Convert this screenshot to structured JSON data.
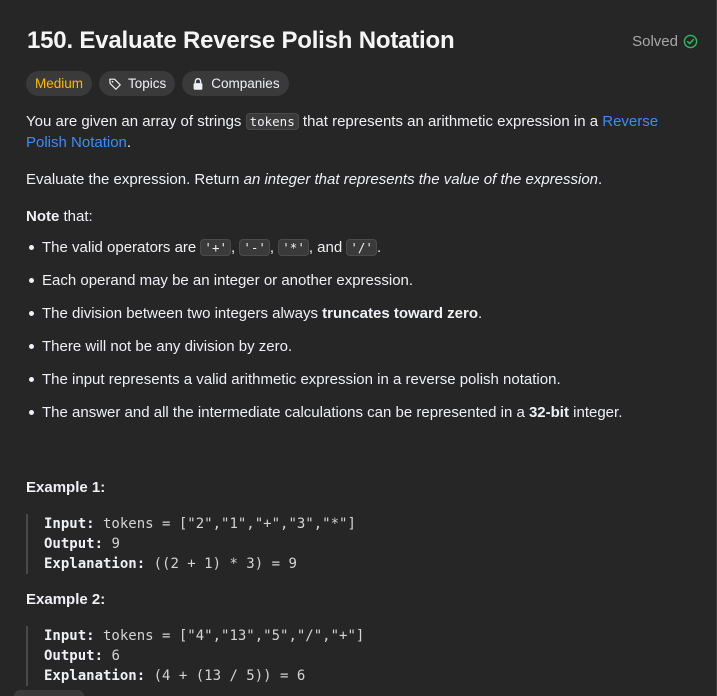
{
  "problem": {
    "title": "150. Evaluate Reverse Polish Notation",
    "status": "Solved"
  },
  "tags": {
    "difficulty": "Medium",
    "topics": "Topics",
    "companies": "Companies"
  },
  "description": {
    "p1_a": "You are given an array of strings ",
    "p1_code": "tokens",
    "p1_b": " that represents an arithmetic expression in a ",
    "p1_link": "Reverse Polish Notation",
    "p1_c": ".",
    "p2_a": "Evaluate the expression. Return ",
    "p2_italic": "an integer that represents the value of the expression",
    "p2_b": ".",
    "note_bold": "Note",
    "note_rest": " that:"
  },
  "notes": {
    "n1_a": "The valid operators are ",
    "op_plus": "'+'",
    "op_minus": "'-'",
    "op_mult": "'*'",
    "op_div": "'/'",
    "sep1": ", ",
    "sep2": ", ",
    "sep3": ", and ",
    "n1_end": ".",
    "n2": "Each operand may be an integer or another expression.",
    "n3_a": "The division between two integers always ",
    "n3_bold": "truncates toward zero",
    "n3_b": ".",
    "n4": "There will not be any division by zero.",
    "n5": "The input represents a valid arithmetic expression in a reverse polish notation.",
    "n6_a": "The answer and all the intermediate calculations can be represented in a ",
    "n6_bold": "32-bit",
    "n6_b": " integer."
  },
  "examples": [
    {
      "title": "Example 1:",
      "input_label": "Input:",
      "input_value": " tokens = [\"2\",\"1\",\"+\",\"3\",\"*\"]",
      "output_label": "Output:",
      "output_value": " 9",
      "explanation_label": "Explanation:",
      "explanation_value": " ((2 + 1) * 3) = 9"
    },
    {
      "title": "Example 2:",
      "input_label": "Input:",
      "input_value": " tokens = [\"4\",\"13\",\"5\",\"/\",\"+\"]",
      "output_label": "Output:",
      "output_value": " 6",
      "explanation_label": "Explanation:",
      "explanation_value": " (4 + (13 / 5)) = 6"
    }
  ],
  "colors": {
    "background": "#262626",
    "medium": "#ffb800",
    "link": "#3b8cfe",
    "solved_check": "#2cbb5d"
  }
}
